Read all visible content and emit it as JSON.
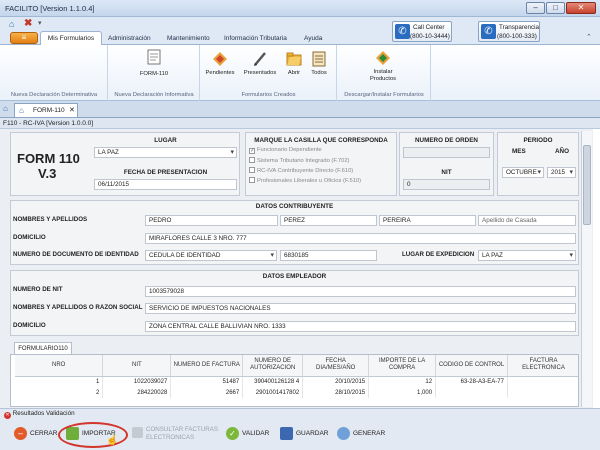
{
  "window": {
    "title": "FACILITO [Version 1.1.0.4]"
  },
  "ribbon": {
    "app_button": "≡",
    "tabs": [
      "Mis Formularios",
      "Administración",
      "Mantenimiento",
      "Información Tributaria",
      "Ayuda"
    ],
    "call_center": {
      "line1": "Call Center",
      "line2": "(800-10-3444)"
    },
    "transparencia": {
      "line1": "Transparencia",
      "line2": "(800-100-333)"
    },
    "form_button": "FORM-110",
    "creados_buttons": [
      "Pendientes",
      "Presentados",
      "Abrir",
      "Todos"
    ],
    "install_button": "Instalar Productos",
    "group_labels": [
      "Nueva Declaración Determinativa",
      "Nueva Declaración Informativa",
      "Formularios Creados",
      "Descargar/Instalar Formularios"
    ]
  },
  "doc_tab": {
    "label": "FORM-110",
    "close": "✕"
  },
  "form": {
    "header": "F110 - RC-IVA [Version 1.0.0.0]",
    "title_line1": "FORM 110",
    "title_line2": "V.3",
    "lugar_label": "LUGAR",
    "lugar_value": "LA PAZ",
    "fecha_label": "FECHA DE PRESENTACION",
    "fecha_value": "06/11/2015",
    "casilla_label": "MARQUE LA CASILLA QUE CORRESPONDA",
    "casillas": [
      {
        "label": "Funcionario Dependiente",
        "checked": true
      },
      {
        "label": "Sistema Tributario Integrado (F.702)",
        "checked": false
      },
      {
        "label": "RC-IVA Contribuyente Directo (F.610)",
        "checked": false
      },
      {
        "label": "Profesionales Liberales u Oficios (F.510)",
        "checked": false
      }
    ],
    "orden_label": "NUMERO DE ORDEN",
    "orden_value": "",
    "nit_label": "NIT",
    "nit_value": "0",
    "periodo_label": "PERIODO",
    "mes_label": "MES",
    "anio_label": "AÑO",
    "mes_value": "OCTUBRE",
    "anio_value": "2015",
    "contribuyente": {
      "section": "DATOS CONTRIBUYENTE",
      "nombres_label": "NOMBRES Y APELLIDOS",
      "nombre": "PEDRO",
      "paterno": "PEREZ",
      "materno": "PEREIRA",
      "casada": "Apellido de Casada",
      "domicilio_label": "DOMICILIO",
      "domicilio": "MIRAFLORES CALLE 3 NRO. 777",
      "doc_label": "NUMERO DE DOCUMENTO DE IDENTIDAD",
      "doc_tipo": "CEDULA DE IDENTIDAD",
      "doc_numero": "6830185",
      "expedicion_label": "LUGAR DE EXPEDICION",
      "expedicion": "LA PAZ"
    },
    "empleador": {
      "section": "DATOS EMPLEADOR",
      "nit_label": "NUMERO DE NIT",
      "nit": "1003579028",
      "razon_label": "NOMBRES Y APELLIDOS O RAZON SOCIAL",
      "razon": "SERVICIO DE IMPUESTOS NACIONALES",
      "domicilio_label": "DOMICILIO",
      "domicilio": "ZONA CENTRAL CALLE BALLIVIAN NRO. 1333"
    },
    "grid_tab": "FORMULARIO110",
    "grid": {
      "columns": [
        "NRO",
        "NIT",
        "NUMERO DE FACTURA",
        "NUMERO DE AUTORIZACION",
        "FECHA DIA/MES/AÑO",
        "IMPORTE DE LA COMPRA",
        "CODIGO DE CONTROL",
        "FACTURA ELECTRONICA"
      ],
      "rows": [
        [
          "1",
          "1022039027",
          "51487",
          "390400126128 4",
          "20/10/2015",
          "12",
          "63-28-A3-EA-77",
          ""
        ],
        [
          "2",
          "284220028",
          "2667",
          "2901001417802",
          "28/10/2015",
          "1,000",
          "",
          ""
        ]
      ]
    }
  },
  "status": {
    "validation": "Resultados Validación"
  },
  "actions": {
    "cerrar": "CERRAR",
    "importar": "IMPORTAR",
    "consultar": "CONSULTAR FACTURAS ELECTRONICAS",
    "validar": "VALIDAR",
    "guardar": "GUARDAR",
    "generar": "GENERAR"
  }
}
